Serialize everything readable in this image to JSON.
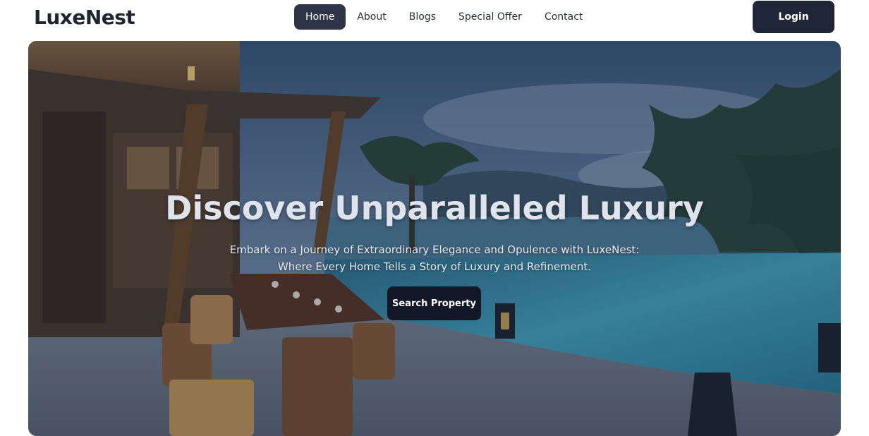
{
  "brand": "LuxeNest",
  "nav": {
    "items": [
      {
        "label": "Home",
        "active": true
      },
      {
        "label": "About",
        "active": false
      },
      {
        "label": "Blogs",
        "active": false
      },
      {
        "label": "Special Offer",
        "active": false
      },
      {
        "label": "Contact",
        "active": false
      }
    ],
    "login_label": "Login"
  },
  "hero": {
    "title": "Discover Unparalleled Luxury",
    "subtitle_line1": "Embark on a Journey of Extraordinary Elegance and Opulence with LuxeNest:",
    "subtitle_line2": "Where Every Home Tells a Story of Luxury and Refinement.",
    "cta_label": "Search Property",
    "image": "luxury-villa-pool-terrace-photo"
  },
  "colors": {
    "primary_dark": "#1f2637",
    "nav_active": "#2e3546",
    "cta": "#121826"
  }
}
